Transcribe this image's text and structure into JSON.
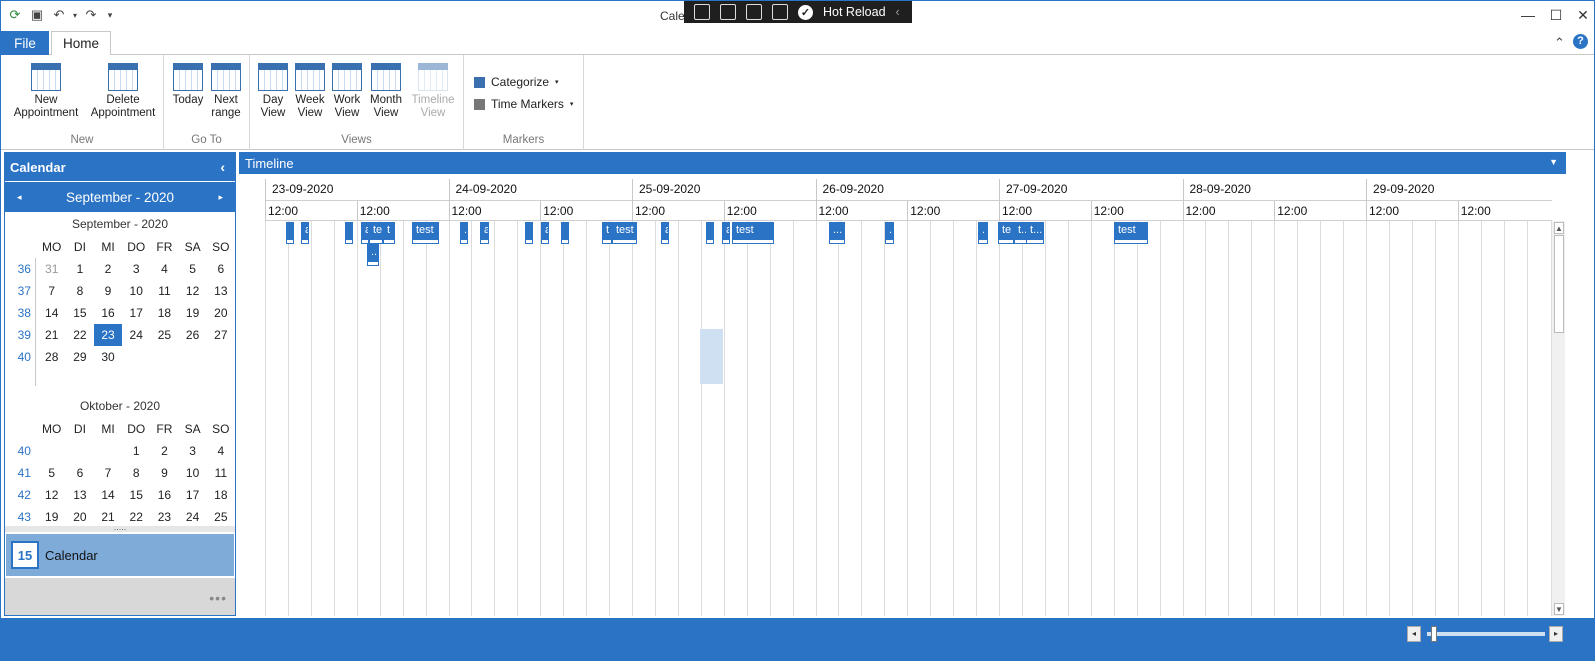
{
  "window": {
    "title_partial": "Cale",
    "hot_reload_label": "Hot Reload",
    "hot_reload_arrow": "‹",
    "controls": {
      "minimize": "—",
      "maximize": "☐",
      "close": "✕"
    }
  },
  "quick_access": {
    "app_icon": "app-icon",
    "save_icon": "save-icon",
    "undo_icon": "undo-icon",
    "redo_icon": "redo-icon",
    "customize_icon": "customize-icon"
  },
  "ribbon": {
    "tabs": {
      "file": "File",
      "home": "Home"
    },
    "collapse": "⌃",
    "help": "?",
    "groups": {
      "new": {
        "label": "New",
        "new_appointment": "New\nAppointment",
        "delete_appointment": "Delete\nAppointment"
      },
      "goto": {
        "label": "Go To",
        "today": "Today",
        "next_range": "Next\nrange"
      },
      "views": {
        "label": "Views",
        "day": "Day\nView",
        "week": "Week\nView",
        "work": "Work\nView",
        "month": "Month\nView",
        "timeline": "Timeline\nView"
      },
      "markers": {
        "label": "Markers",
        "categorize": "Categorize",
        "time_markers": "Time Markers"
      }
    }
  },
  "nav": {
    "header": "Calendar",
    "collapse": "‹",
    "month_nav": {
      "prev": "◂",
      "title": "September - 2020",
      "next": "▸"
    },
    "months": [
      {
        "title": "September - 2020",
        "weekdays": [
          "MO",
          "DI",
          "MI",
          "DO",
          "FR",
          "SA",
          "SO"
        ],
        "weeks": [
          {
            "wk": "36",
            "days": [
              "31",
              "1",
              "2",
              "3",
              "4",
              "5",
              "6"
            ]
          },
          {
            "wk": "37",
            "days": [
              "7",
              "8",
              "9",
              "10",
              "11",
              "12",
              "13"
            ]
          },
          {
            "wk": "38",
            "days": [
              "14",
              "15",
              "16",
              "17",
              "18",
              "19",
              "20"
            ]
          },
          {
            "wk": "39",
            "days": [
              "21",
              "22",
              "23",
              "24",
              "25",
              "26",
              "27"
            ]
          },
          {
            "wk": "40",
            "days": [
              "28",
              "29",
              "30",
              "",
              "",
              "",
              ""
            ]
          }
        ],
        "selected": "23"
      },
      {
        "title": "Oktober - 2020",
        "weekdays": [
          "MO",
          "DI",
          "MI",
          "DO",
          "FR",
          "SA",
          "SO"
        ],
        "weeks": [
          {
            "wk": "40",
            "days": [
              "",
              "",
              "",
              "1",
              "2",
              "3",
              "4"
            ]
          },
          {
            "wk": "41",
            "days": [
              "5",
              "6",
              "7",
              "8",
              "9",
              "10",
              "11"
            ]
          },
          {
            "wk": "42",
            "days": [
              "12",
              "13",
              "14",
              "15",
              "16",
              "17",
              "18"
            ]
          },
          {
            "wk": "43",
            "days": [
              "19",
              "20",
              "21",
              "22",
              "23",
              "24",
              "25"
            ]
          }
        ]
      }
    ],
    "calendar_button": {
      "label": "Calendar",
      "icon_text": "15"
    },
    "more": "•••",
    "splitter": "....."
  },
  "timeline": {
    "header": "Timeline",
    "dropdown": "▼",
    "dates": [
      "23-09-2020",
      "24-09-2020",
      "25-09-2020",
      "26-09-2020",
      "27-09-2020",
      "28-09-2020",
      "29-09-2020"
    ],
    "hour_label": "12:00",
    "appointments": [
      {
        "text": ""
      },
      {
        "text": "a"
      },
      {
        "text": ""
      },
      {
        "text": "a"
      },
      {
        "text": "te"
      },
      {
        "text": "t"
      },
      {
        "text": "..."
      },
      {
        "text": "test"
      },
      {
        "text": "."
      },
      {
        "text": "a"
      },
      {
        "text": ""
      },
      {
        "text": "a"
      },
      {
        "text": ""
      },
      {
        "text": "t"
      },
      {
        "text": "test"
      },
      {
        "text": "a"
      },
      {
        "text": ""
      },
      {
        "text": "a"
      },
      {
        "text": "test"
      },
      {
        "text": "..."
      },
      {
        "text": "."
      },
      {
        "text": "."
      },
      {
        "text": "te"
      },
      {
        "text": "t..."
      },
      {
        "text": "t..."
      },
      {
        "text": "test"
      }
    ]
  },
  "status": {
    "zoom_left": "◂",
    "zoom_right": "▸"
  },
  "colors": {
    "accent": "#2b73c5",
    "selection": "#cfe0f2",
    "nav_selected": "#7fabd9"
  }
}
